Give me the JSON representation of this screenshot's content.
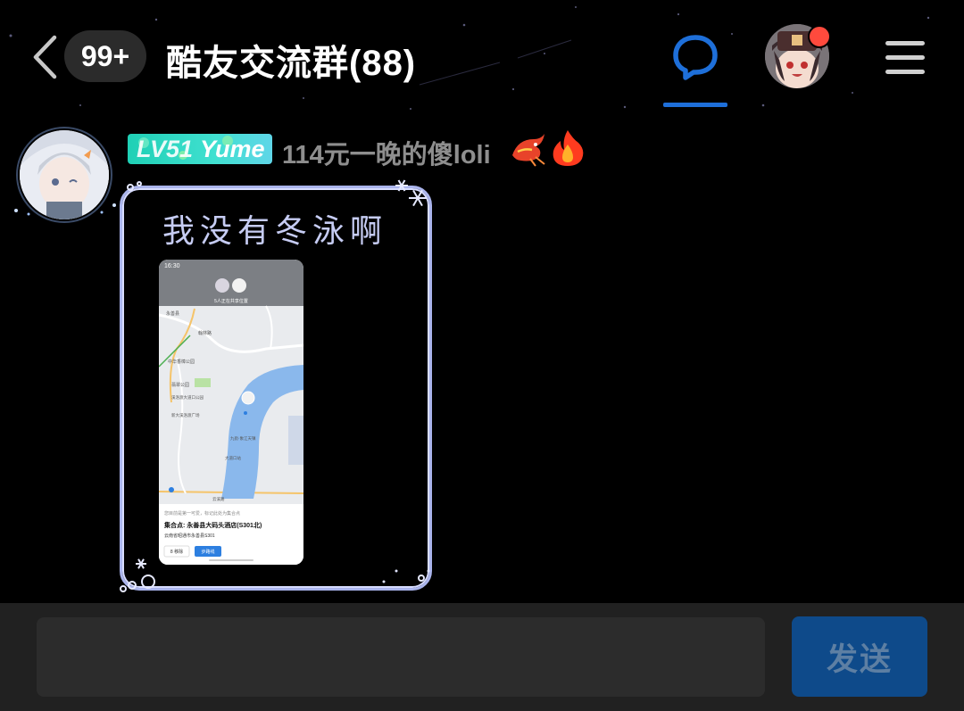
{
  "header": {
    "unread_count": "99+",
    "title": "酷友交流群(88)",
    "icons": {
      "back": "chevron-left-icon",
      "chat": "chat-bubble-icon",
      "menu": "hamburger-menu-icon"
    },
    "accent_color": "#1e6fd9",
    "notification_color": "#ff4a3d"
  },
  "message": {
    "level_badge": {
      "level": "LV51",
      "name": "Yume"
    },
    "sender_name": "114元一晚的傻loli",
    "text": "我没有冬泳啊",
    "badges": [
      "dragon-icon",
      "fire-icon"
    ],
    "image": {
      "status_time": "16:30",
      "share_label": "5人正在共享位置",
      "map_labels": [
        "翰林路",
        "永善县",
        "中华香樟公园",
        "翡翠公园",
        "溪洛渡大道口公园",
        "新大溪洛渡广场",
        "九街·象江天镇",
        "大道口站",
        "云溪路"
      ],
      "notice": "您目前是第一可爱，标记此处为集合点",
      "meeting_point": "集合点: 永善县大码头酒店(S301北)",
      "address": "云南省昭通市永善县S301",
      "btn_remove": "8 移除",
      "btn_route": "步路线"
    }
  },
  "input": {
    "placeholder": "",
    "send_label": "发送"
  }
}
